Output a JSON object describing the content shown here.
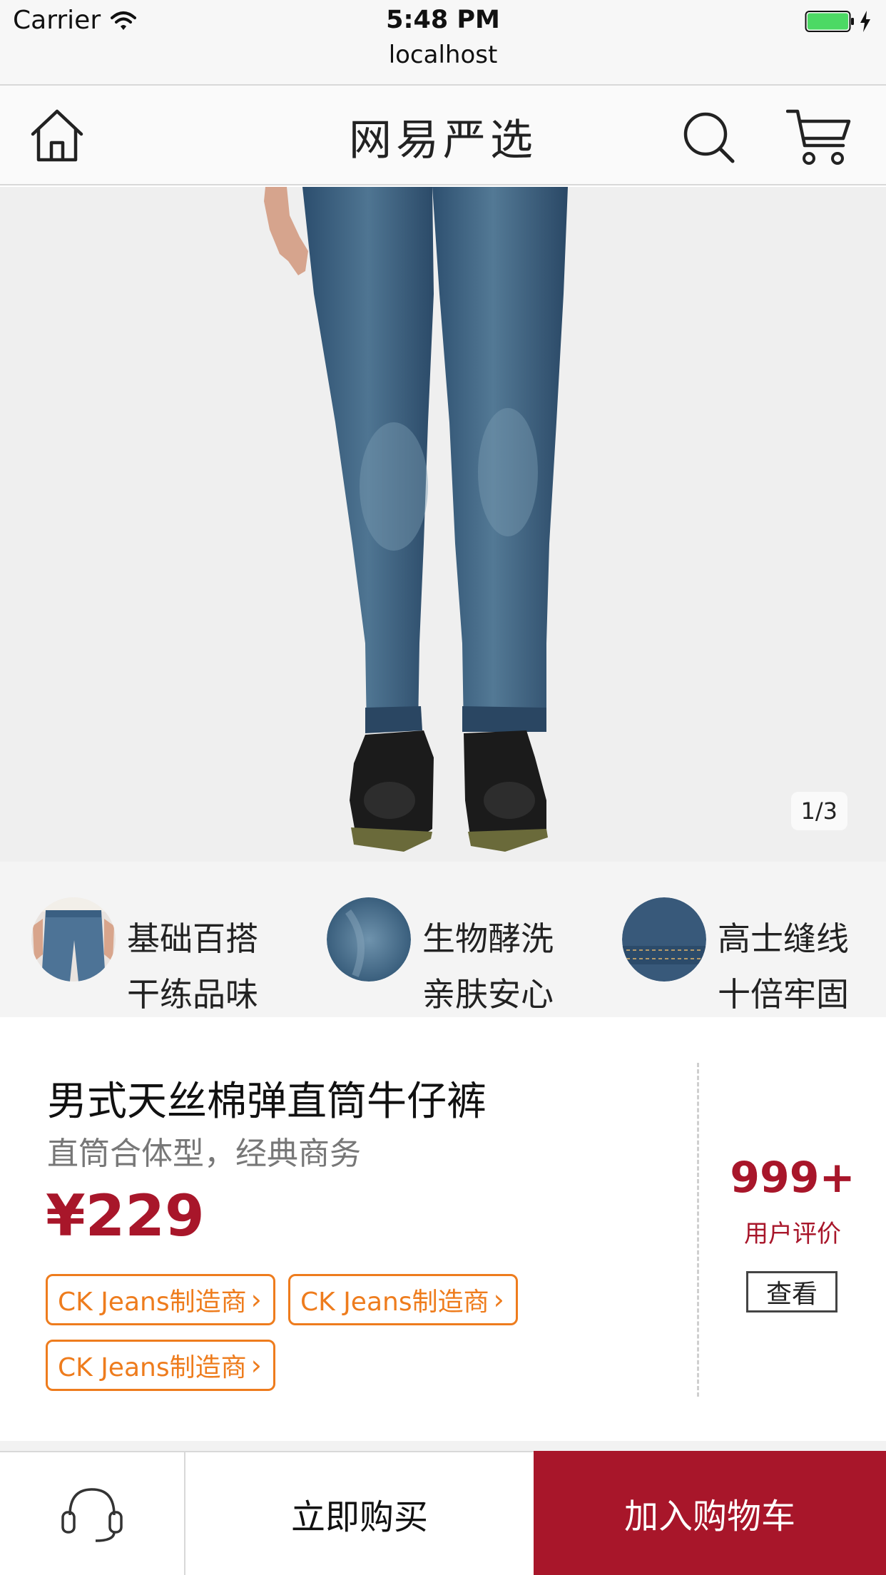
{
  "status_bar": {
    "carrier": "Carrier",
    "time": "5:48 PM",
    "url": "localhost",
    "icons": [
      "wifi-icon",
      "battery-icon",
      "charging-bolt-icon"
    ]
  },
  "nav": {
    "title": "网易严选",
    "icons": [
      "home-icon",
      "search-icon",
      "cart-icon"
    ]
  },
  "hero": {
    "counter": "1/3"
  },
  "features": [
    {
      "line1": "基础百搭",
      "line2": "干练品味",
      "thumb": "jeans-model-thumbnail"
    },
    {
      "line1": "生物酵洗",
      "line2": "亲肤安心",
      "thumb": "denim-fabric-thumbnail"
    },
    {
      "line1": "高士缝线",
      "line2": "十倍牢固",
      "thumb": "denim-stitching-thumbnail"
    }
  ],
  "product": {
    "title": "男式天丝棉弹直筒牛仔裤",
    "subtitle": "直筒合体型，经典商务",
    "price": "¥229",
    "tags": [
      "CK Jeans制造商",
      "CK Jeans制造商",
      "CK Jeans制造商"
    ]
  },
  "reviews": {
    "count": "999+",
    "label": "用户评价",
    "button": "查看"
  },
  "bottom_bar": {
    "buy_now": "立即购买",
    "add_to_cart": "加入购物车",
    "service_icon": "headset-icon"
  },
  "colors": {
    "brand_red": "#a8162a",
    "tag_orange": "#ee7c1d",
    "battery_green": "#4cd964"
  }
}
